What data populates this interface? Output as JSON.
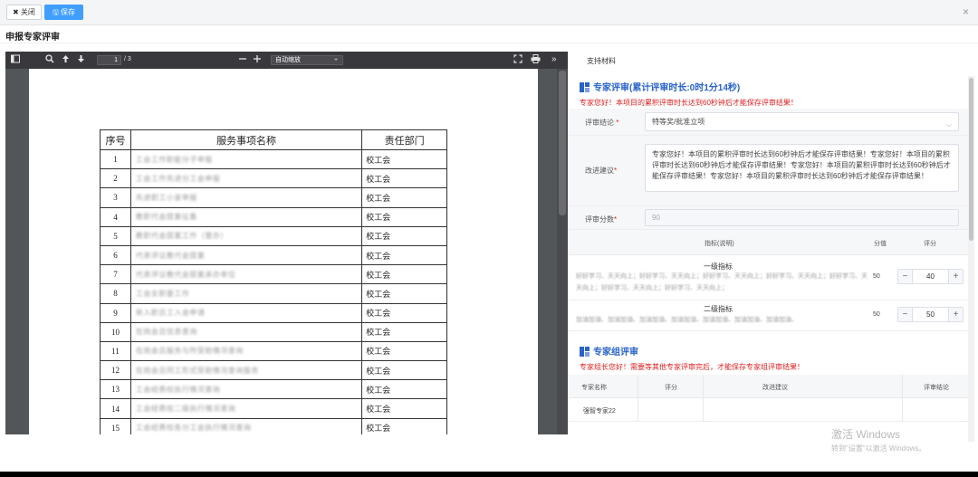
{
  "toolbar": {
    "close_label": "✖ 关闭",
    "save_label": "🖫 保存",
    "dismiss_label": "×"
  },
  "page_title": "申报专家评审",
  "pdf": {
    "page_number": "1",
    "page_total": "/ 3",
    "zoom_label": "自动缩放",
    "table": {
      "headers": [
        "序号",
        "服务事项名称",
        "责任部门"
      ],
      "rows": [
        {
          "no": "1",
          "name": "工会工作职能分子申报",
          "dept": "校工会"
        },
        {
          "no": "2",
          "name": "工会工作先进分工会申报",
          "dept": "校工会"
        },
        {
          "no": "3",
          "name": "先进职工小家申报",
          "dept": "校工会"
        },
        {
          "no": "4",
          "name": "教职代会提案征集",
          "dept": "校工会"
        },
        {
          "no": "5",
          "name": "教职代会提案工作（督办）",
          "dept": "校工会"
        },
        {
          "no": "6",
          "name": "代表评议教代会提案",
          "dept": "校工会"
        },
        {
          "no": "7",
          "name": "代表评议教代会提案承办单位",
          "dept": "校工会"
        },
        {
          "no": "8",
          "name": "工会女职委工作",
          "dept": "校工会"
        },
        {
          "no": "9",
          "name": "新入职员工入会申请",
          "dept": "校工会"
        },
        {
          "no": "10",
          "name": "在岗会员信息查询",
          "dept": "校工会"
        },
        {
          "no": "11",
          "name": "在岗会员服务与所受助情况查询",
          "dept": "校工会"
        },
        {
          "no": "12",
          "name": "在岗会员同工形式受助情况查询服务",
          "dept": "校工会"
        },
        {
          "no": "13",
          "name": "工会经费校执行情况查询",
          "dept": "校工会"
        },
        {
          "no": "14",
          "name": "工会经费校二级执行情况查询",
          "dept": "校工会"
        },
        {
          "no": "15",
          "name": "工会经费校各分工会执行情况查询",
          "dept": "校工会"
        }
      ]
    }
  },
  "right": {
    "tab_label": "支持材料",
    "expert": {
      "heading": "专家评审(累计评审时长:0时1分14秒)",
      "warning": "专家您好！本项目的累积评审时长达到60秒钟后才能保存评审结果！",
      "conclusion_label": "评审结论",
      "conclusion_value": "特等奖/批准立项",
      "advice_label": "改进建议",
      "advice_value": "专家您好！本项目的累积评审时长达到60秒钟后才能保存评审结果！专家您好！本项目的累积评审时长达到60秒钟后才能保存评审结果！专家您好！本项目的累积评审时长达到60秒钟后才能保存评审结果！专家您好！本项目的累积评审时长达到60秒钟后才能保存评审结果！",
      "score_label": "评审分数",
      "score_value": "90",
      "index_headers": {
        "name": "指标(说明)",
        "score": "分值",
        "rating": "评分"
      },
      "indexes": [
        {
          "title": "一级指标",
          "desc": "好好学习、天天向上；好好学习、天天向上；好好学习、天天向上；好好学习、天天向上；好好学习、天天向上；好好学习、天天向上；好好学习、天天向上；",
          "score": "50",
          "rating": "40"
        },
        {
          "title": "二级指标",
          "desc": "加油加油、加油加油、加油加油、加油加油、加油加油、加油加油、加油加油、",
          "score": "50",
          "rating": "50"
        }
      ],
      "stepper_minus": "−",
      "stepper_plus": "+"
    },
    "group": {
      "heading": "专家组评审",
      "warning": "专家组长您好！需要等其他专家评审完后，才能保存专家组评审结果！",
      "headers": [
        "专家名称",
        "评分",
        "改进建议",
        "评审结论"
      ],
      "rows": [
        {
          "name": "强智专家22",
          "score": "",
          "advice": "",
          "conclusion": ""
        }
      ]
    }
  },
  "watermark": {
    "line1": "激活 Windows",
    "line2": "转到\"设置\"以激活 Windows。"
  },
  "colors": {
    "primary": "#409eff",
    "heading": "#2a63c9",
    "warning": "#e02020"
  }
}
